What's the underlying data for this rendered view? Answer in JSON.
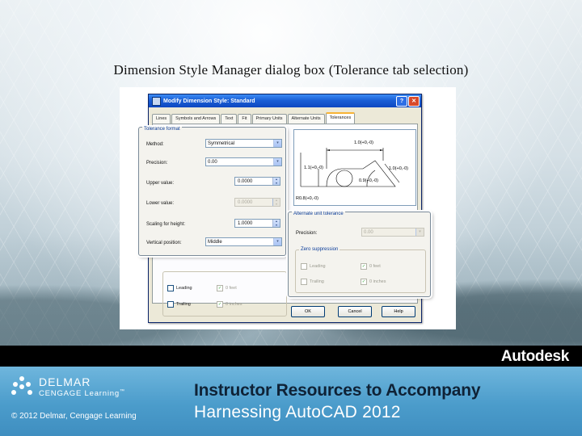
{
  "slide": {
    "title": "Dimension Style Manager dialog box (Tolerance tab selection)"
  },
  "dialog": {
    "title": "Modify Dimension Style: Standard",
    "help_button": "?",
    "close_button": "✕",
    "tabs": [
      "Lines",
      "Symbols and Arrows",
      "Text",
      "Fit",
      "Primary Units",
      "Alternate Units",
      "Tolerances"
    ],
    "active_tab": "Tolerances",
    "preview_labels": [
      "1.0(+0,-0)",
      "1.1(+0,-0)",
      "1.0(+0,-0)",
      "0.9(+0,-0)",
      "R0.8(+0,-0)"
    ],
    "back_group": {
      "leading_label": "Leading",
      "feet_label": "0 feet",
      "trailing_label": "Trailing",
      "inches_label": "0 inches"
    },
    "buttons": {
      "ok": "OK",
      "cancel": "Cancel",
      "help": "Help"
    }
  },
  "tolerance_format": {
    "legend": "Tolerance format",
    "method_label": "Method:",
    "method_value": "Symmetrical",
    "precision_label": "Precision:",
    "precision_value": "0.00",
    "upper_label": "Upper value:",
    "upper_value": "0.0000",
    "lower_label": "Lower value:",
    "lower_value": "0.0000",
    "scaling_label": "Scaling for height:",
    "scaling_value": "1.0000",
    "vertical_label": "Vertical position:",
    "vertical_value": "Middle"
  },
  "alternate_unit_tolerance": {
    "legend": "Alternate unit tolerance",
    "precision_label": "Precision:",
    "precision_value": "0.00",
    "zero_legend": "Zero suppression",
    "leading_label": "Leading",
    "feet_label": "0 feet",
    "trailing_label": "Trailing",
    "inches_label": "0 inches"
  },
  "icons": {
    "dropdown": "▾",
    "check": "✓",
    "spin_up": "▴",
    "spin_down": "▾"
  },
  "banner": {
    "brand": "Autodesk",
    "publisher_name": "DELMAR",
    "publisher_sub": "CENGAGE Learning",
    "publisher_tm": "™",
    "copyright": "© 2012 Delmar, Cengage Learning",
    "headline": "Instructor Resources to Accompany",
    "subheadline": "Harnessing AutoCAD 2012"
  },
  "colors": {
    "title_bar": "#1b5fd6",
    "banner_blue": "#4b9ccb",
    "banner_black": "#000000",
    "headline_dark": "#0f2236"
  }
}
